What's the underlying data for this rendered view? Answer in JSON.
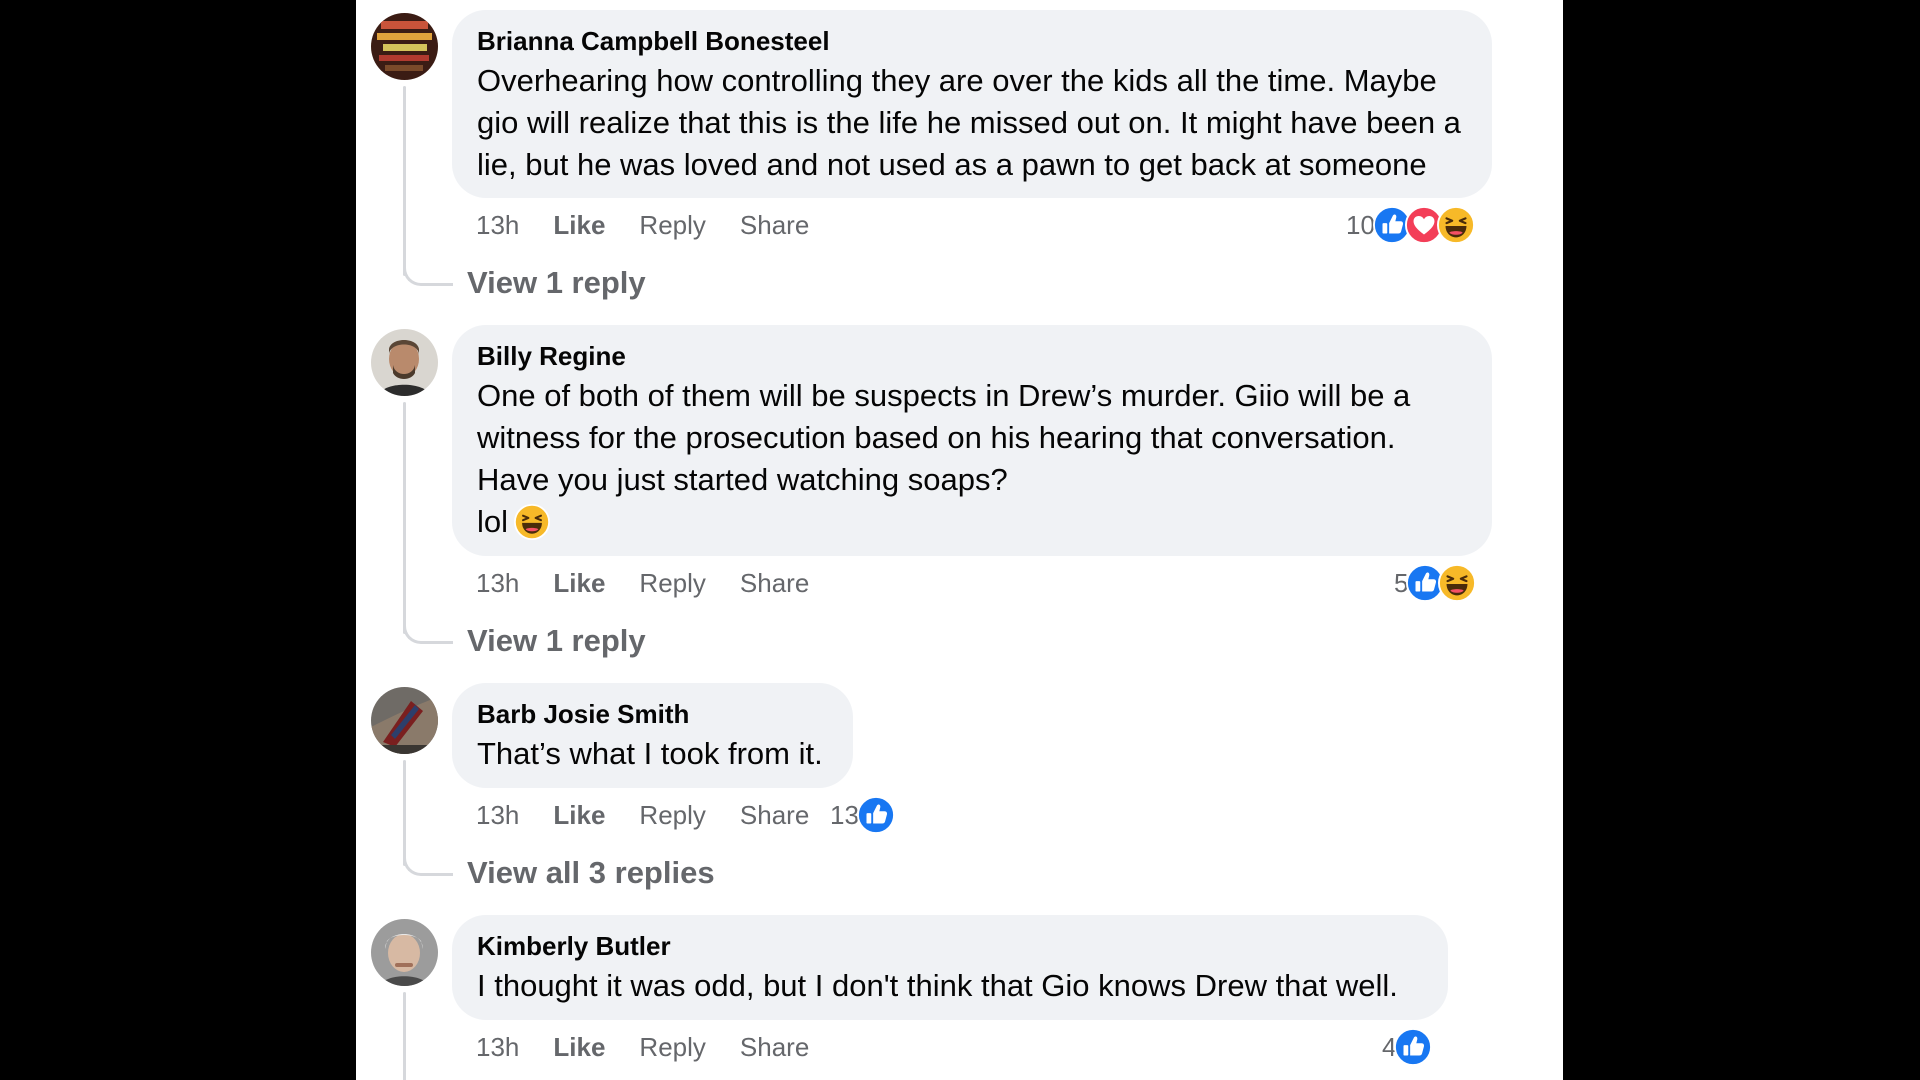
{
  "comments": [
    {
      "author": "Brianna Campbell Bonesteel",
      "text": "Overhearing how controlling they are over the kids all the time. Maybe gio will realize that this is the life he missed out on. It might have been a lie, but he was loved and not used as a pawn to get back at someone",
      "time": "13h",
      "like": "Like",
      "reply": "Reply",
      "share": "Share",
      "reaction_count": "10",
      "reaction_icons": [
        "like-icon",
        "love-icon",
        "haha-icon"
      ],
      "view_replies": "View 1 reply"
    },
    {
      "author": "Billy Regine",
      "text": "One of both of them will be suspects in Drew’s murder. Giio will be a witness for the prosecution based on his hearing that conversation. Have you just started watching soaps?",
      "text_last_line": "lol",
      "text_emoji": "laughing-emoji",
      "time": "13h",
      "like": "Like",
      "reply": "Reply",
      "share": "Share",
      "reaction_count": "5",
      "reaction_icons": [
        "like-icon",
        "haha-icon"
      ],
      "view_replies": "View 1 reply"
    },
    {
      "author": "Barb Josie Smith",
      "text": "That’s what I took from it.",
      "time": "13h",
      "like": "Like",
      "reply": "Reply",
      "share": "Share",
      "reaction_count": "13",
      "reaction_icons": [
        "like-icon"
      ],
      "view_replies": "View all 3 replies"
    },
    {
      "author": "Kimberly Butler",
      "text": "I thought it was odd, but I don't think that Gio knows Drew that well.",
      "time": "13h",
      "like": "Like",
      "reply": "Reply",
      "share": "Share",
      "reaction_count": "4",
      "reaction_icons": [
        "like-icon"
      ]
    }
  ],
  "colors": {
    "bubble": "#f0f2f5",
    "secondary_text": "#65676b",
    "like_blue": "#1877f2",
    "love_red": "#f33e58",
    "haha_yellow": "#f7b928"
  }
}
